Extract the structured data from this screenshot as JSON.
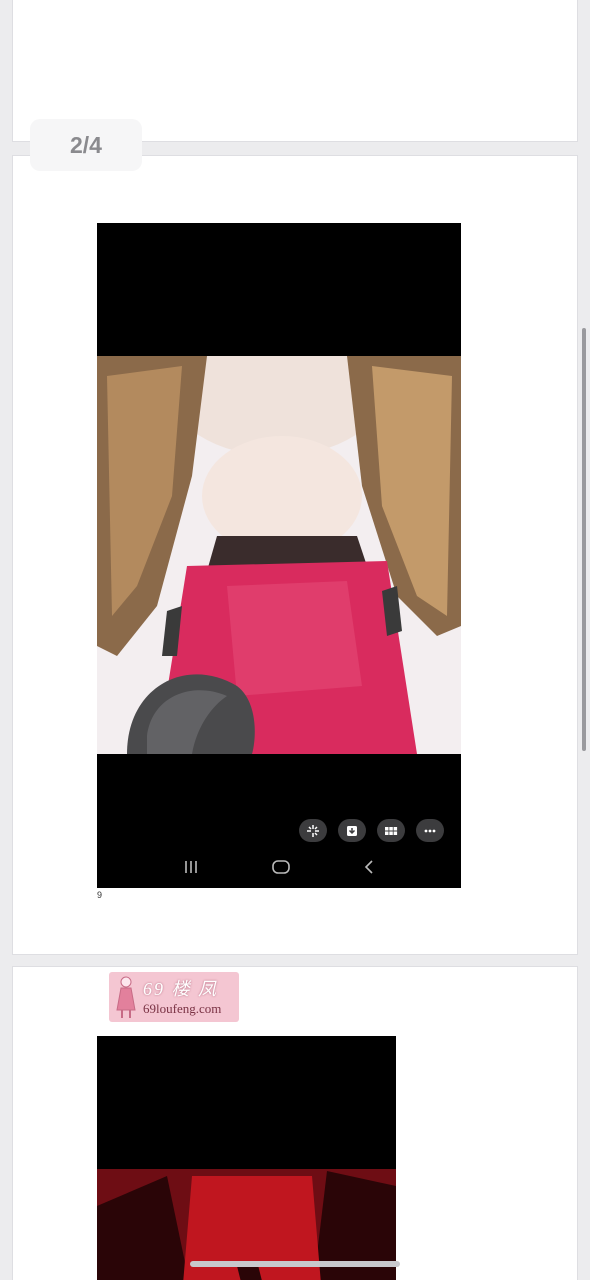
{
  "pager": {
    "indicator": "2/4"
  },
  "post_image": {
    "actions": [
      {
        "icon": "sparkle-icon"
      },
      {
        "icon": "download-icon"
      },
      {
        "icon": "grid-icon"
      },
      {
        "icon": "more-icon"
      }
    ],
    "nav": [
      {
        "icon": "recents-icon"
      },
      {
        "icon": "home-icon"
      },
      {
        "icon": "back-icon"
      }
    ],
    "caption": "9"
  },
  "watermark": {
    "title": "69 楼 凤",
    "url": "69loufeng.com"
  },
  "colors": {
    "page_background": "#ececee",
    "card": "#ffffff",
    "dress": "#d92b5e",
    "watermark_bg": "#f4c6d2"
  }
}
